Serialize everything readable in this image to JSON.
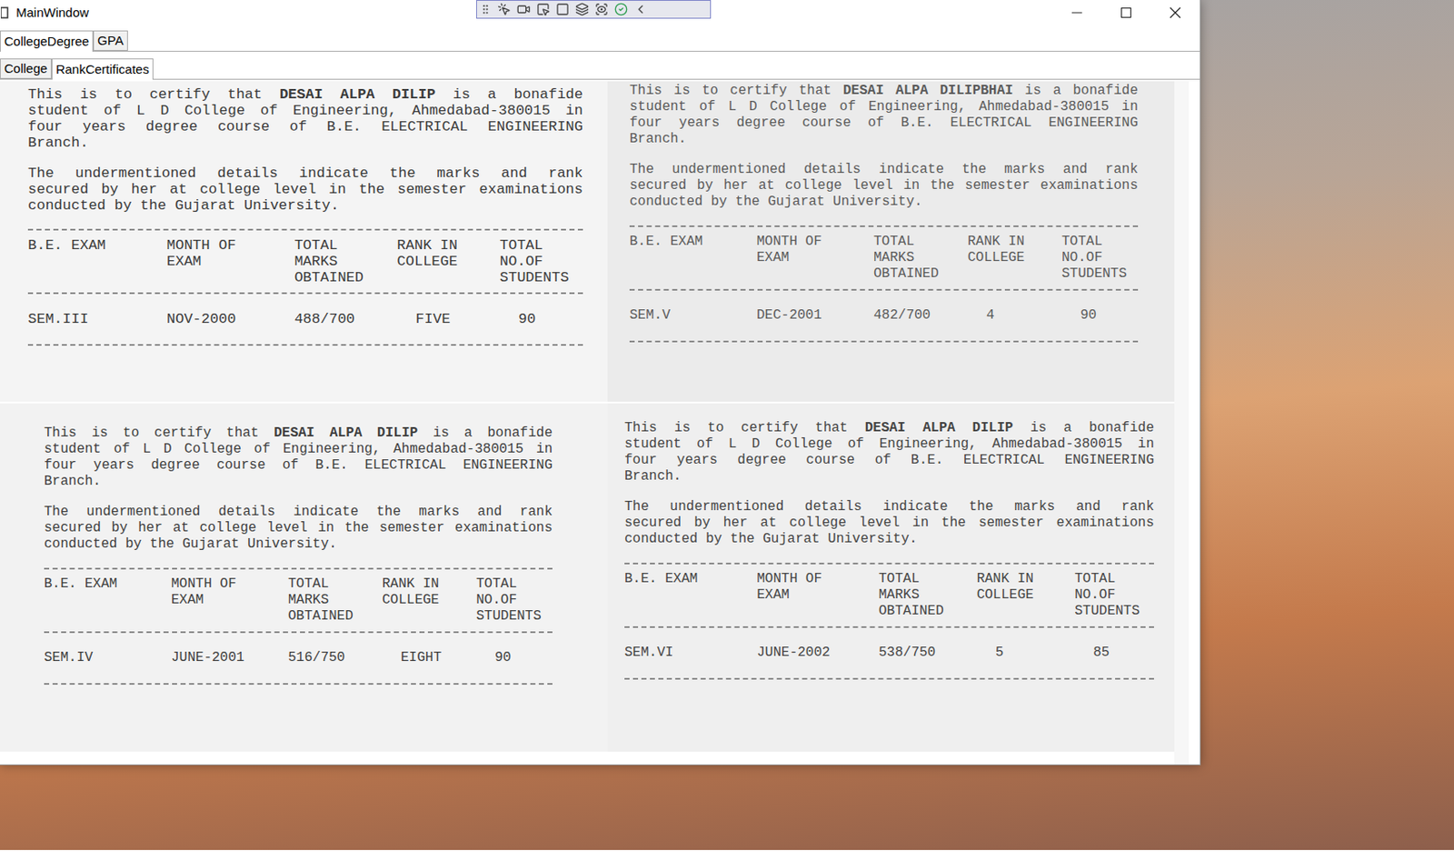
{
  "window": {
    "title": "MainWindow"
  },
  "tabs": [
    {
      "label": "CollegeDegree",
      "selected": true
    },
    {
      "label": "GPA",
      "selected": false
    }
  ],
  "subtabs": [
    {
      "label": "College",
      "selected": false
    },
    {
      "label": "RankCertificates",
      "selected": true
    }
  ],
  "columns": [
    [
      "B.E. EXAM"
    ],
    [
      "MONTH OF",
      "EXAM"
    ],
    [
      "TOTAL",
      "MARKS",
      "OBTAINED"
    ],
    [
      "RANK IN",
      "COLLEGE"
    ],
    [
      "TOTAL",
      "NO.OF",
      "STUDENTS"
    ]
  ],
  "certificates": [
    {
      "intro_prefix": "This is to certify that ",
      "name": "DESAI ALPA DILIP",
      "intro_suffix": " is a bonafide",
      "lines": [
        "student of L D College of Engineering, Ahmedabad-380015 in",
        "four years degree course of B.E. ELECTRICAL ENGINEERING",
        "Branch."
      ],
      "para2": [
        "The undermentioned details indicate the marks and rank",
        "secured by her at college level in the semester examinations",
        "conducted by the Gujarat University."
      ],
      "row": [
        "SEM.III",
        "NOV-2000",
        "488/700",
        "FIVE",
        "90"
      ]
    },
    {
      "intro_prefix": "This is to certify that ",
      "name": "DESAI ALPA DILIPBHAI",
      "intro_suffix": " is a bonafide",
      "lines": [
        "student of L D College of Engineering, Ahmedabad-380015 in",
        "four years degree course of B.E. ELECTRICAL ENGINEERING",
        "Branch."
      ],
      "para2": [
        "The undermentioned details indicate the marks and rank",
        "secured by her at college level in the semester examinations",
        "conducted by the Gujarat University."
      ],
      "row": [
        "SEM.V",
        "DEC-2001",
        "482/700",
        "4",
        "90"
      ]
    },
    {
      "intro_prefix": "This is to certify that ",
      "name": "DESAI ALPA DILIP",
      "intro_suffix": " is a bonafide",
      "lines": [
        "student of L D College of Engineering, Ahmedabad-380015 in",
        "four years degree course of B.E. ELECTRICAL ENGINEERING",
        "Branch."
      ],
      "para2": [
        "The undermentioned details indicate the marks and rank",
        "secured by her at college level in the semester examinations",
        "conducted by the Gujarat University."
      ],
      "row": [
        "SEM.IV",
        "JUNE-2001",
        "516/750",
        "EIGHT",
        "90"
      ]
    },
    {
      "intro_prefix": "This is to certify that ",
      "name": "DESAI ALPA DILIP",
      "intro_suffix": " is a bonafide",
      "lines": [
        "student of L D College of Engineering, Ahmedabad-380015 in",
        "four years degree course of B.E. ELECTRICAL ENGINEERING",
        "Branch."
      ],
      "para2": [
        "The undermentioned details indicate the marks and rank",
        "secured by her at college level in the semester examinations",
        "conducted by the Gujarat University."
      ],
      "row": [
        "SEM.VI",
        "JUNE-2002",
        "538/750",
        "5",
        "85"
      ]
    }
  ]
}
